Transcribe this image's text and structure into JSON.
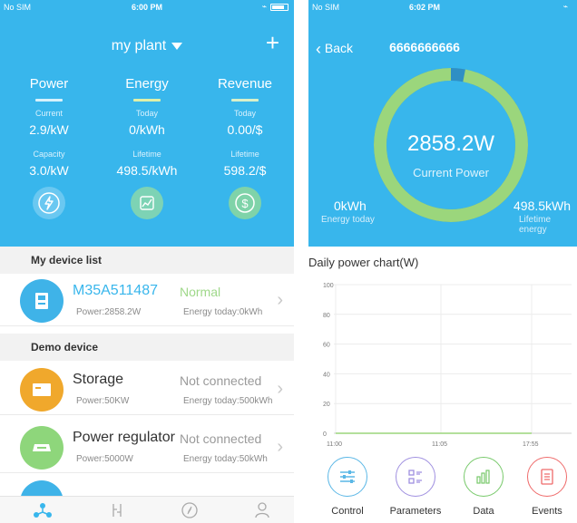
{
  "left": {
    "status": {
      "carrier": "No SIM",
      "time": "6:00 PM"
    },
    "title": "my plant",
    "add_label": "+",
    "summary": [
      {
        "head": "Power",
        "lbl1": "Current",
        "val1": "2.9/kW",
        "lbl2": "Capacity",
        "val2": "3.0/kW",
        "icon": "lightning-icon"
      },
      {
        "head": "Energy",
        "lbl1": "Today",
        "val1": "0/kWh",
        "lbl2": "Lifetime",
        "val2": "498.5/kWh",
        "icon": "chart-icon"
      },
      {
        "head": "Revenue",
        "lbl1": "Today",
        "val1": "0.00/$",
        "lbl2": "Lifetime",
        "val2": "598.2/$",
        "icon": "dollar-icon"
      }
    ],
    "my_devices_header": "My device list",
    "demo_header": "Demo device",
    "devices": [
      {
        "name": "M35A511487",
        "status": "Normal",
        "power": "Power:2858.2W",
        "energy": "Energy today:0kWh",
        "color": "#3fb3e8",
        "name_color": "#38b6ec",
        "status_color": "#9fd88a",
        "icon": "inverter-icon"
      },
      {
        "name": "Storage",
        "status": "Not connected",
        "power": "Power:50KW",
        "energy": "Energy today:500kWh",
        "color": "#f0a82c",
        "name_color": "#333333",
        "status_color": "#9a9a9a",
        "icon": "battery-icon"
      },
      {
        "name": "Power regulator",
        "status": "Not connected",
        "power": "Power:5000W",
        "energy": "Energy today:50kWh",
        "color": "#8ed67b",
        "name_color": "#333333",
        "status_color": "#9a9a9a",
        "icon": "regulator-icon"
      }
    ],
    "tabs": [
      "plant-tab-icon",
      "device-tab-icon",
      "compass-tab-icon",
      "user-tab-icon"
    ]
  },
  "right": {
    "status": {
      "carrier": "No SIM",
      "time": "6:02 PM"
    },
    "back_label": "Back",
    "title": "6666666666",
    "current_value": "2858.2W",
    "current_label": "Current Power",
    "energy_today_value": "0kWh",
    "energy_today_label": "Energy today",
    "lifetime_value": "498.5kWh",
    "lifetime_label": "Lifetime energy",
    "ring_fill": 0.98,
    "chart_title": "Daily power chart(W)",
    "buttons": [
      {
        "label": "Control",
        "color": "#5ab7e6",
        "icon": "sliders-icon"
      },
      {
        "label": "Parameters",
        "color": "#9f8fe0",
        "icon": "list-icon"
      },
      {
        "label": "Data",
        "color": "#77c96a",
        "icon": "bar-chart-icon"
      },
      {
        "label": "Events",
        "color": "#ef6a6a",
        "icon": "document-icon"
      }
    ]
  },
  "chart_data": {
    "type": "line",
    "title": "Daily power chart(W)",
    "xlabel": "",
    "ylabel": "",
    "ylim": [
      0,
      100
    ],
    "y_ticks": [
      0,
      20,
      40,
      60,
      80,
      100
    ],
    "x_ticks": [
      "11:00",
      "11:05",
      "17:55"
    ],
    "series": [
      {
        "x": [
          "11:00",
          "11:05",
          "17:55"
        ],
        "values": [
          0,
          0,
          0
        ]
      }
    ],
    "grid": true,
    "legend": "none"
  }
}
